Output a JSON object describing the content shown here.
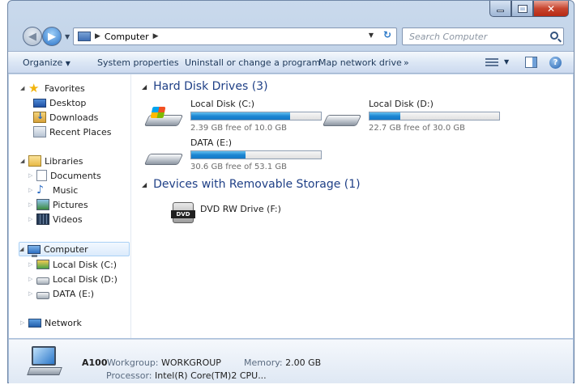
{
  "address": {
    "path": "Computer",
    "search_placeholder": "Search Computer"
  },
  "commands": {
    "organize": "Organize",
    "system_properties": "System properties",
    "uninstall": "Uninstall or change a program",
    "map_drive": "Map network drive",
    "more": "»"
  },
  "nav": {
    "favorites": "Favorites",
    "desktop": "Desktop",
    "downloads": "Downloads",
    "recent_places": "Recent Places",
    "libraries": "Libraries",
    "documents": "Documents",
    "music": "Music",
    "pictures": "Pictures",
    "videos": "Videos",
    "computer": "Computer",
    "local_c": "Local Disk (C:)",
    "local_d": "Local Disk (D:)",
    "data_e": "DATA (E:)",
    "network": "Network"
  },
  "groups": {
    "hard_disks": "Hard Disk Drives (3)",
    "removable": "Devices with Removable Storage (1)"
  },
  "drives": [
    {
      "name": "Local Disk (C:)",
      "free_text": "2.39 GB free of 10.0 GB",
      "used_fraction": 0.76
    },
    {
      "name": "Local Disk (D:)",
      "free_text": "22.7 GB free of 30.0 GB",
      "used_fraction": 0.24
    },
    {
      "name": "DATA (E:)",
      "free_text": "30.6 GB free of 53.1 GB",
      "used_fraction": 0.42
    }
  ],
  "dvd": {
    "name": "DVD RW Drive (F:)",
    "logo": "DVD"
  },
  "details": {
    "name": "A100",
    "workgroup_label": "Workgroup:",
    "workgroup": "WORKGROUP",
    "memory_label": "Memory:",
    "memory": "2.00 GB",
    "processor_label": "Processor:",
    "processor": "Intel(R) Core(TM)2 CPU..."
  },
  "colors": {
    "accent": "#1e3f86",
    "bar_fill": "#1d86d2",
    "close": "#c7452f"
  },
  "icons": [
    "back-icon",
    "forward-icon",
    "computer-icon",
    "search-icon",
    "refresh-icon",
    "views-icon",
    "preview-pane-icon",
    "help-icon",
    "star-icon",
    "desktop-icon",
    "downloads-icon",
    "recent-places-icon",
    "libraries-icon",
    "documents-icon",
    "music-icon",
    "pictures-icon",
    "videos-icon",
    "hard-drive-icon",
    "dvd-drive-icon",
    "network-icon"
  ]
}
